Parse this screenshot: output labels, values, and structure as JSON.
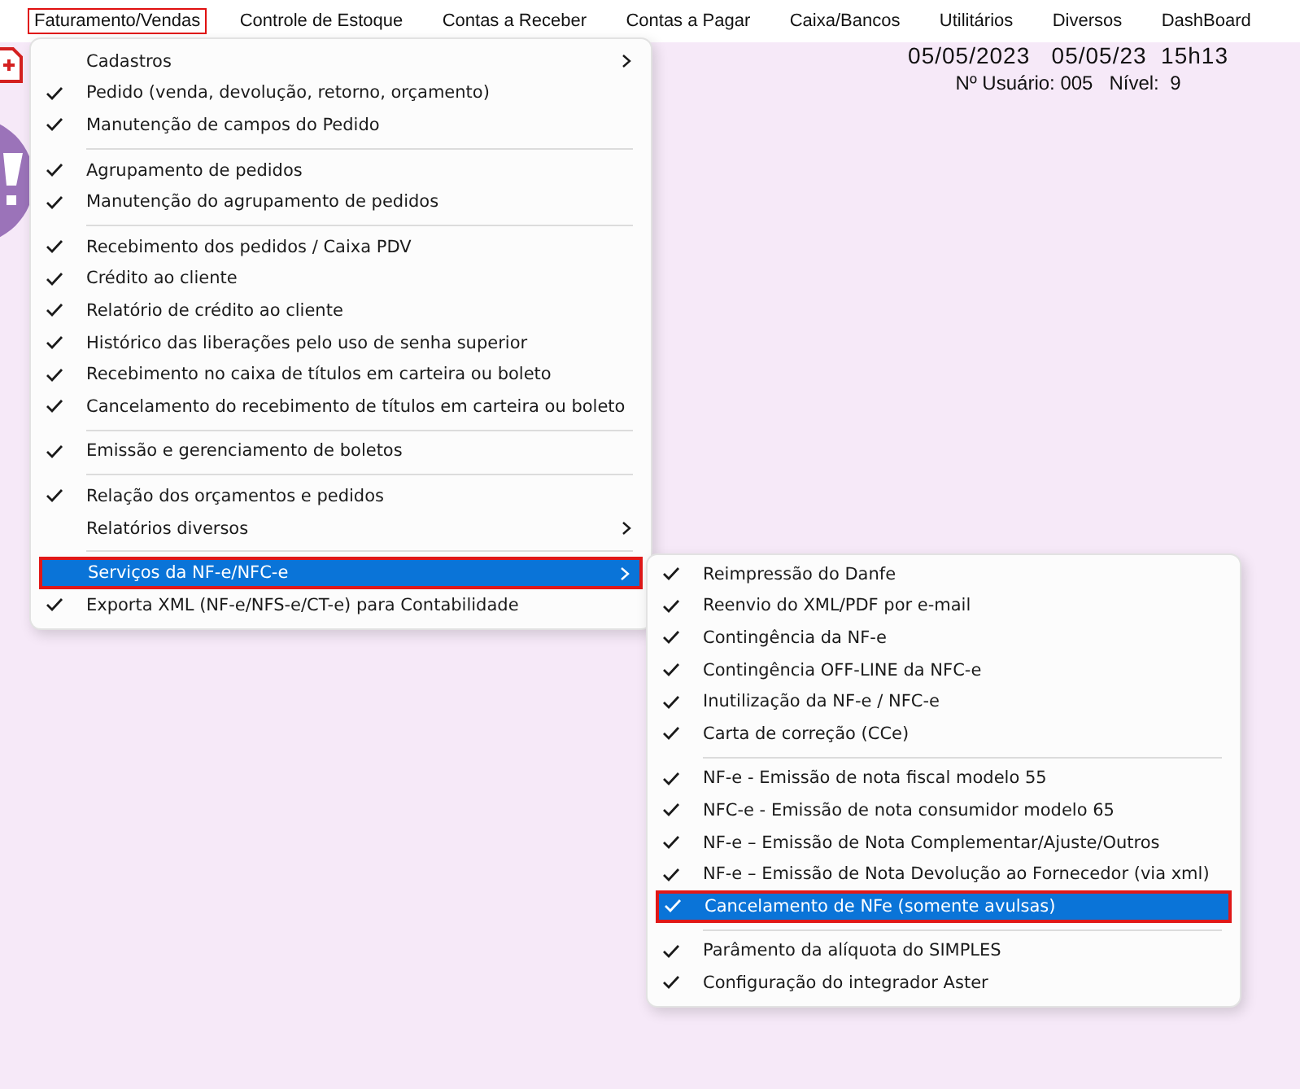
{
  "menubar": [
    {
      "label": "Faturamento/Vendas",
      "selected": true
    },
    {
      "label": "Controle de Estoque",
      "selected": false
    },
    {
      "label": "Contas a Receber",
      "selected": false
    },
    {
      "label": "Contas a Pagar",
      "selected": false
    },
    {
      "label": "Caixa/Bancos",
      "selected": false
    },
    {
      "label": "Utilitários",
      "selected": false
    },
    {
      "label": "Diversos",
      "selected": false
    },
    {
      "label": "DashBoard",
      "selected": false
    }
  ],
  "info": {
    "date_line": "05/05/2023   05/05/23  15h13",
    "user_line": "Nº Usuário: 005   Nível:  9"
  },
  "menu": [
    {
      "kind": "item",
      "label": "Cadastros",
      "checked": false,
      "submenu": true,
      "selected": false
    },
    {
      "kind": "item",
      "label": "Pedido (venda, devolução, retorno, orçamento)",
      "checked": true,
      "submenu": false,
      "selected": false
    },
    {
      "kind": "item",
      "label": "Manutenção de campos do Pedido",
      "checked": true,
      "submenu": false,
      "selected": false
    },
    {
      "kind": "separator"
    },
    {
      "kind": "item",
      "label": "Agrupamento de pedidos",
      "checked": true,
      "submenu": false,
      "selected": false
    },
    {
      "kind": "item",
      "label": "Manutenção do agrupamento de pedidos",
      "checked": true,
      "submenu": false,
      "selected": false
    },
    {
      "kind": "separator"
    },
    {
      "kind": "item",
      "label": "Recebimento dos pedidos / Caixa PDV",
      "checked": true,
      "submenu": false,
      "selected": false
    },
    {
      "kind": "item",
      "label": "Crédito ao cliente",
      "checked": true,
      "submenu": false,
      "selected": false
    },
    {
      "kind": "item",
      "label": "Relatório de crédito ao cliente",
      "checked": true,
      "submenu": false,
      "selected": false
    },
    {
      "kind": "item",
      "label": "Histórico das liberações pelo uso de senha superior",
      "checked": true,
      "submenu": false,
      "selected": false
    },
    {
      "kind": "item",
      "label": "Recebimento no caixa de títulos em carteira ou boleto",
      "checked": true,
      "submenu": false,
      "selected": false
    },
    {
      "kind": "item",
      "label": "Cancelamento do recebimento de títulos em carteira ou boleto",
      "checked": true,
      "submenu": false,
      "selected": false
    },
    {
      "kind": "separator"
    },
    {
      "kind": "item",
      "label": "Emissão e gerenciamento de boletos",
      "checked": true,
      "submenu": false,
      "selected": false
    },
    {
      "kind": "separator"
    },
    {
      "kind": "item",
      "label": "Relação dos orçamentos e pedidos",
      "checked": true,
      "submenu": false,
      "selected": false
    },
    {
      "kind": "item",
      "label": "Relatórios diversos",
      "checked": false,
      "submenu": true,
      "selected": false
    },
    {
      "kind": "separator"
    },
    {
      "kind": "item",
      "label": "Serviços da NF-e/NFC-e",
      "checked": false,
      "submenu": true,
      "selected": true
    },
    {
      "kind": "item",
      "label": "Exporta XML (NF-e/NFS-e/CT-e) para Contabilidade",
      "checked": true,
      "submenu": false,
      "selected": false
    }
  ],
  "submenu": [
    {
      "kind": "item",
      "label": "Reimpressão do Danfe",
      "checked": true,
      "submenu": false,
      "selected": false
    },
    {
      "kind": "item",
      "label": "Reenvio do XML/PDF por e-mail",
      "checked": true,
      "submenu": false,
      "selected": false
    },
    {
      "kind": "item",
      "label": "Contingência da NF-e",
      "checked": true,
      "submenu": false,
      "selected": false
    },
    {
      "kind": "item",
      "label": "Contingência OFF-LINE da NFC-e",
      "checked": true,
      "submenu": false,
      "selected": false
    },
    {
      "kind": "item",
      "label": "Inutilização da NF-e / NFC-e",
      "checked": true,
      "submenu": false,
      "selected": false
    },
    {
      "kind": "item",
      "label": "Carta de correção (CCe)",
      "checked": true,
      "submenu": false,
      "selected": false
    },
    {
      "kind": "separator"
    },
    {
      "kind": "item",
      "label": "NF-e - Emissão de nota fiscal modelo 55",
      "checked": true,
      "submenu": false,
      "selected": false
    },
    {
      "kind": "item",
      "label": "NFC-e - Emissão de nota consumidor modelo 65",
      "checked": true,
      "submenu": false,
      "selected": false
    },
    {
      "kind": "item",
      "label": "NF-e – Emissão de Nota Complementar/Ajuste/Outros",
      "checked": true,
      "submenu": false,
      "selected": false
    },
    {
      "kind": "item",
      "label": "NF-e – Emissão de Nota Devolução ao Fornecedor (via xml)",
      "checked": true,
      "submenu": false,
      "selected": false
    },
    {
      "kind": "item",
      "label": "Cancelamento de NFe (somente avulsas)",
      "checked": true,
      "submenu": false,
      "selected": true
    },
    {
      "kind": "separator"
    },
    {
      "kind": "item",
      "label": "Parâmento da alíquota do SIMPLES",
      "checked": true,
      "submenu": false,
      "selected": false
    },
    {
      "kind": "item",
      "label": "Configuração do integrador Aster",
      "checked": true,
      "submenu": false,
      "selected": false
    }
  ]
}
